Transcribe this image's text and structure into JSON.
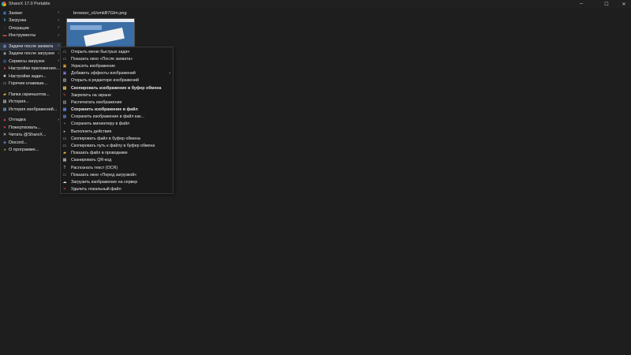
{
  "window": {
    "title": "ShareX 17.0 Portable",
    "controls": {
      "minimize": "─",
      "maximize": "☐",
      "close": "✕"
    }
  },
  "sidebar": {
    "items": [
      {
        "label": "Захват",
        "icon": "camera-icon",
        "glyph": "▣",
        "color": "#3a7bd5",
        "arrow": "›"
      },
      {
        "label": "Загрузка",
        "icon": "upload-icon",
        "glyph": "⬆",
        "color": "#3aa0e0",
        "arrow": "›"
      },
      {
        "label": "Операции",
        "icon": "tools-icon",
        "glyph": "⋮",
        "color": "#4aa3df",
        "arrow": "›"
      },
      {
        "label": "Инструменты",
        "icon": "toolbox-icon",
        "glyph": "▬",
        "color": "#d9534f",
        "arrow": "›"
      },
      {
        "label": "Задачи после захвата",
        "icon": "after-capture-icon",
        "glyph": "▣",
        "color": "#6a8fc7",
        "arrow": "›"
      },
      {
        "label": "Задачи после загрузки",
        "icon": "after-upload-icon",
        "glyph": "◉",
        "color": "#9aa3ad",
        "arrow": "›"
      },
      {
        "label": "Сервисы загрузок",
        "icon": "services-icon",
        "glyph": "◍",
        "color": "#3b8ad9",
        "arrow": "›"
      },
      {
        "label": "Настройки приложения...",
        "icon": "settings-icon",
        "glyph": "●",
        "color": "#e04848",
        "arrow": ""
      },
      {
        "label": "Настройки задач...",
        "icon": "task-settings-icon",
        "glyph": "✹",
        "color": "#c8c8c8",
        "arrow": ""
      },
      {
        "label": "Горячие клавиши...",
        "icon": "hotkeys-icon",
        "glyph": "▭",
        "color": "#c8c8c8",
        "arrow": ""
      },
      {
        "label": "Папка скриншотов...",
        "icon": "folder-icon",
        "glyph": "▰",
        "color": "#e8b84a",
        "arrow": ""
      },
      {
        "label": "История...",
        "icon": "history-icon",
        "glyph": "▤",
        "color": "#e8e8e8",
        "arrow": ""
      },
      {
        "label": "История изображений...",
        "icon": "image-history-icon",
        "glyph": "▦",
        "color": "#7aa6d9",
        "arrow": ""
      },
      {
        "label": "Отладка",
        "icon": "debug-icon",
        "glyph": "▲",
        "color": "#d9534f",
        "arrow": "›"
      },
      {
        "label": "Пожертвовать...",
        "icon": "heart-icon",
        "glyph": "♥",
        "color": "#e0405a",
        "arrow": ""
      },
      {
        "label": "Читать @ShareX...",
        "icon": "x-icon",
        "glyph": "✕",
        "color": "#e8e8e8",
        "arrow": ""
      },
      {
        "label": "Discord...",
        "icon": "discord-icon",
        "glyph": "◈",
        "color": "#7289da",
        "arrow": ""
      },
      {
        "label": "О программе...",
        "icon": "about-icon",
        "glyph": "◕",
        "color": "#e0b040",
        "arrow": ""
      }
    ]
  },
  "preview": {
    "filename": "browser_oUvmkB7GIm.png"
  },
  "after_capture_menu": {
    "items": [
      {
        "label": "Открыть меню быстрых задач",
        "icon": "quick-tasks-icon",
        "glyph": "▭",
        "color": "#9ab8e0",
        "bold": false
      },
      {
        "label": "Показать окно «После захвата»",
        "icon": "window-icon",
        "glyph": "▭",
        "color": "#b0b0b0",
        "bold": false
      },
      {
        "label": "Украсить изображение",
        "icon": "beautify-icon",
        "glyph": "▣",
        "color": "#e8a838",
        "bold": false
      },
      {
        "label": "Добавить эффекты изображений",
        "icon": "effects-icon",
        "glyph": "▣",
        "color": "#8a7ad8",
        "bold": false,
        "arrow": "›"
      },
      {
        "label": "Открыть в редакторе изображений",
        "icon": "editor-icon",
        "glyph": "▨",
        "color": "#d8d8d8",
        "bold": false
      },
      {
        "label": "Скопировать изображение в буфер обмена",
        "icon": "copy-image-icon",
        "glyph": "▤",
        "color": "#e8c860",
        "bold": true
      },
      {
        "label": "Закрепить на экране",
        "icon": "pin-icon",
        "glyph": "✎",
        "color": "#e04848",
        "bold": false
      },
      {
        "label": "Распечатать изображение",
        "icon": "printer-icon",
        "glyph": "▥",
        "color": "#c8c8c8",
        "bold": false
      },
      {
        "label": "Сохранить изображение в файл",
        "icon": "save-icon",
        "glyph": "▩",
        "color": "#5a7ad8",
        "bold": true
      },
      {
        "label": "Сохранить изображение в файл как...",
        "icon": "save-as-icon",
        "glyph": "▩",
        "color": "#6a8ae0",
        "bold": false
      },
      {
        "label": "Сохранить миниатюру в файл",
        "icon": "thumbnail-icon",
        "glyph": "▪",
        "color": "#a0a0a0",
        "bold": false
      },
      {
        "label": "Выполнить действия",
        "icon": "actions-icon",
        "glyph": "▸",
        "color": "#b8b8b8",
        "bold": false
      },
      {
        "label": "Скопировать файл в буфер обмена",
        "icon": "copy-file-icon",
        "glyph": "▭",
        "color": "#d0d0d0",
        "bold": false
      },
      {
        "label": "Скопировать путь к файлу в буфер обмена",
        "icon": "copy-path-icon",
        "glyph": "▭",
        "color": "#d0d0d0",
        "bold": false
      },
      {
        "label": "Показать файл в проводнике",
        "icon": "explorer-icon",
        "glyph": "▰",
        "color": "#e8b84a",
        "bold": false
      },
      {
        "label": "Сканировать QR-код",
        "icon": "qr-icon",
        "glyph": "▦",
        "color": "#d8d8d8",
        "bold": false
      },
      {
        "label": "Распознать текст (OCR)",
        "icon": "ocr-icon",
        "glyph": "T",
        "color": "#d8d8d8",
        "bold": false
      },
      {
        "label": "Показать окно «Перед загрузкой»",
        "icon": "before-upload-icon",
        "glyph": "▭",
        "color": "#b0b0b0",
        "bold": false
      },
      {
        "label": "Загрузить изображение на сервер",
        "icon": "cloud-upload-icon",
        "glyph": "☁",
        "color": "#e8e8e8",
        "bold": false
      },
      {
        "label": "Удалить локальный файл",
        "icon": "delete-icon",
        "glyph": "✕",
        "color": "#d04040",
        "bold": false
      }
    ]
  }
}
